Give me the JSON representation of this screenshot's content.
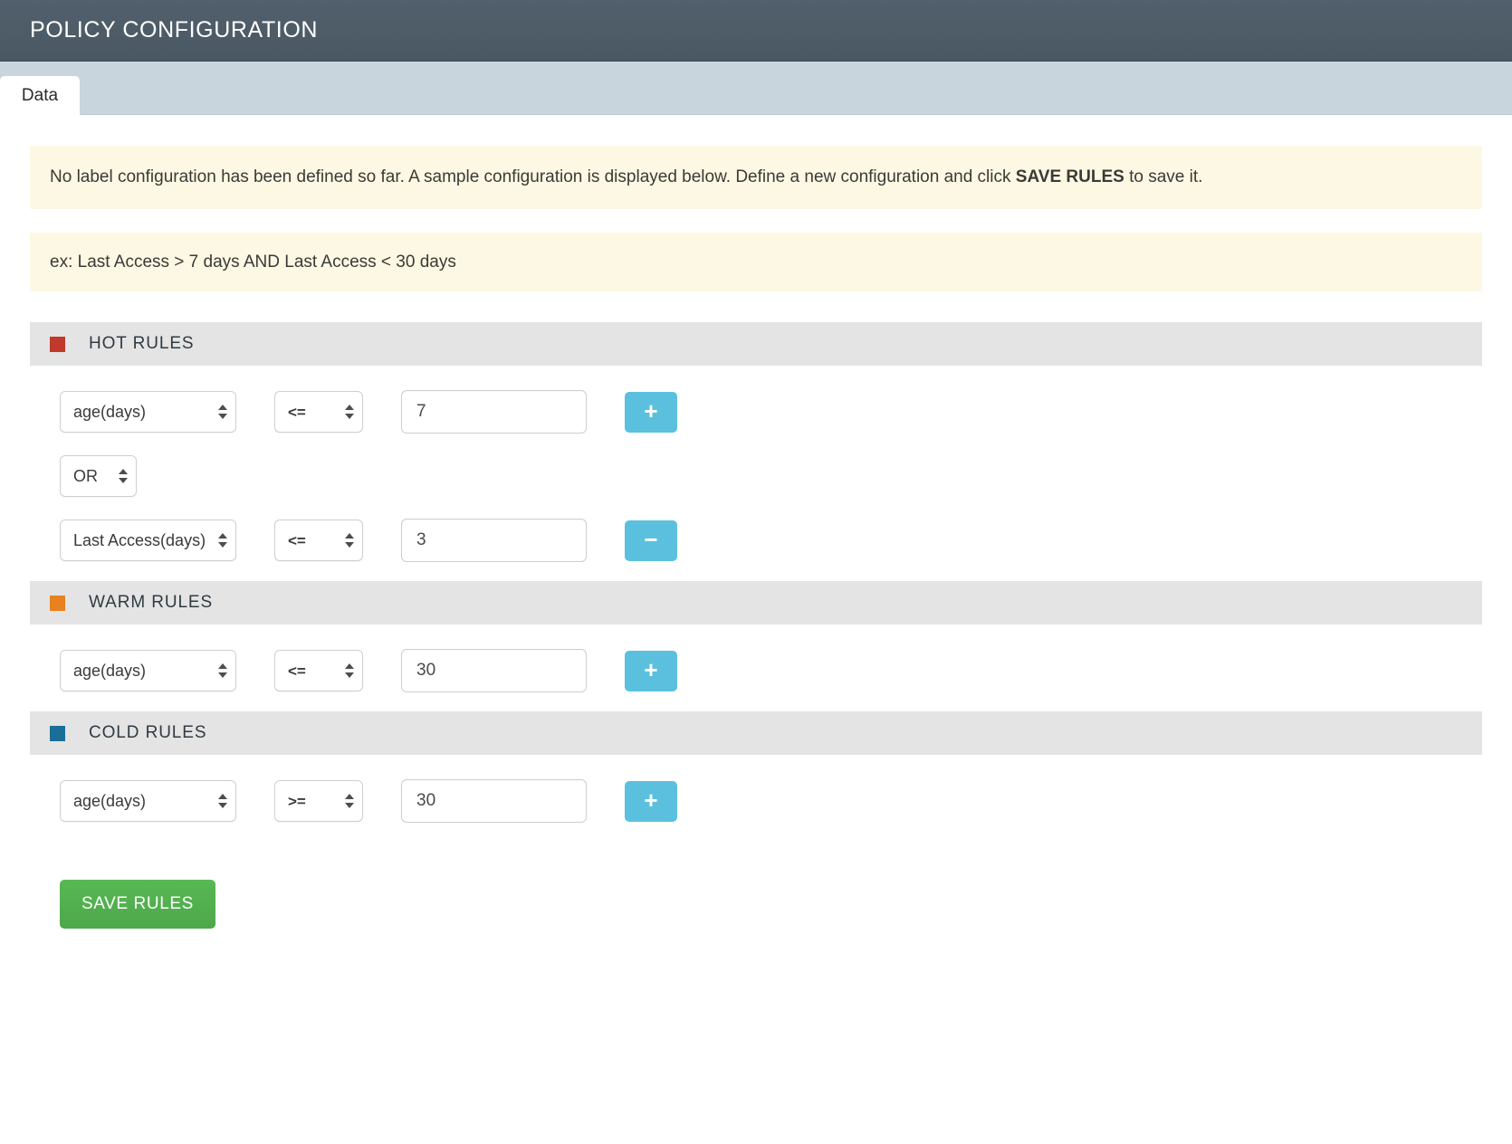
{
  "header": {
    "title": "POLICY CONFIGURATION"
  },
  "tabs": [
    {
      "label": "Data",
      "active": true
    }
  ],
  "alerts": {
    "info_prefix": "No label configuration has been defined so far. A sample configuration is displayed below. Define a new configuration and click ",
    "info_bold": "SAVE RULES",
    "info_suffix": " to save it.",
    "example": "ex: Last Access > 7 days AND Last Access < 30 days"
  },
  "colors": {
    "hot": "#c0392b",
    "warm": "#e8821e",
    "cold": "#1b6f96",
    "accent_button": "#5bc0de",
    "save_button": "#53b14f",
    "header_bar": "#4f5c68",
    "tabstrip": "#c8d5dd",
    "section_header": "#e4e4e4",
    "alert_bg": "#fdf8e3"
  },
  "sections": [
    {
      "id": "hot",
      "title": "HOT RULES",
      "swatch_color": "#c0392b",
      "rows": [
        {
          "type": "condition",
          "field": "age(days)",
          "operator": "<=",
          "value": "7",
          "action_label": "+",
          "action_name": "add-rule-button"
        },
        {
          "type": "logic",
          "logic": "OR"
        },
        {
          "type": "condition",
          "field": "Last Access(days)",
          "operator": "<=",
          "value": "3",
          "action_label": "−",
          "action_name": "remove-rule-button"
        }
      ]
    },
    {
      "id": "warm",
      "title": "WARM RULES",
      "swatch_color": "#e8821e",
      "rows": [
        {
          "type": "condition",
          "field": "age(days)",
          "operator": "<=",
          "value": "30",
          "action_label": "+",
          "action_name": "add-rule-button"
        }
      ]
    },
    {
      "id": "cold",
      "title": "COLD RULES",
      "swatch_color": "#1b6f96",
      "rows": [
        {
          "type": "condition",
          "field": "age(days)",
          "operator": ">=",
          "value": "30",
          "action_label": "+",
          "action_name": "add-rule-button"
        }
      ]
    }
  ],
  "footer": {
    "save_label": "SAVE RULES"
  }
}
